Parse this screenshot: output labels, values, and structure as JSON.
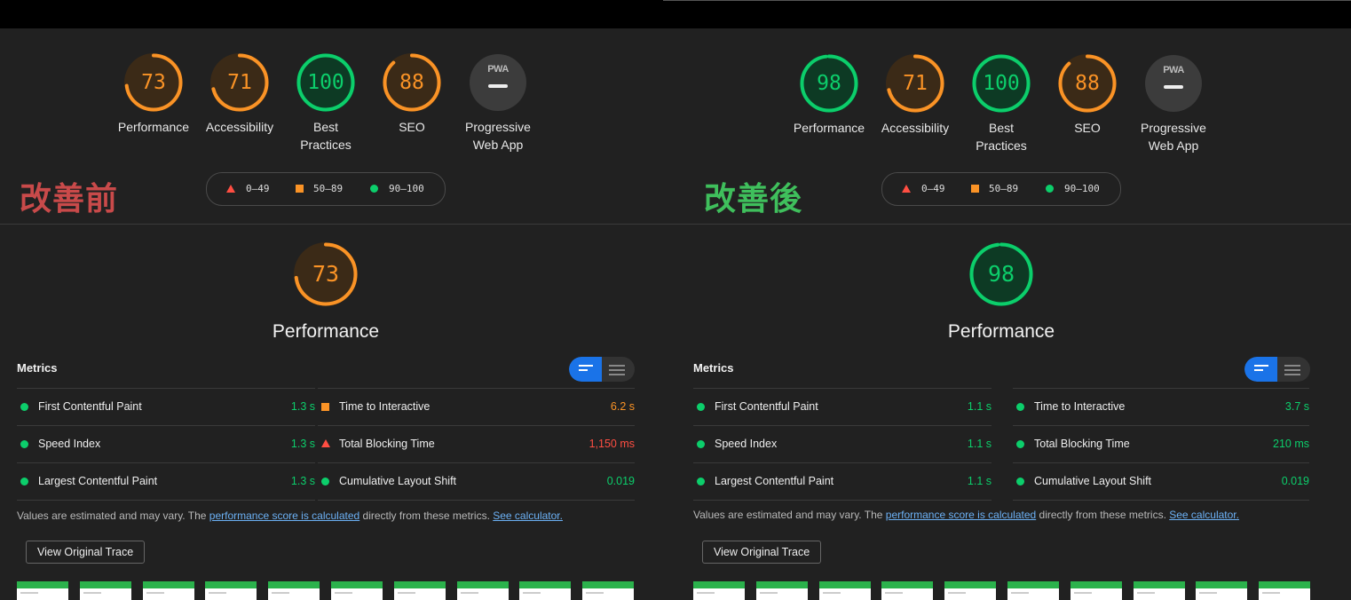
{
  "legend": {
    "low": "0–49",
    "mid": "50–89",
    "high": "90–100"
  },
  "colors": {
    "orange": "#fa9326",
    "green": "#0cce6b",
    "red": "#ff4e42",
    "blue": "#1a73e8"
  },
  "before": {
    "heading": "改善前",
    "heading_color": "#c94a4a",
    "scores": [
      {
        "value": "73",
        "label": "Performance",
        "status": "orange",
        "fraction": 0.73
      },
      {
        "value": "71",
        "label": "Accessibility",
        "status": "orange",
        "fraction": 0.71
      },
      {
        "value": "100",
        "label": "Best Practices",
        "status": "green",
        "fraction": 1.0
      },
      {
        "value": "88",
        "label": "SEO",
        "status": "orange",
        "fraction": 0.88
      }
    ],
    "pwa": {
      "badge": "PWA",
      "label": "Progressive Web App"
    },
    "performance": {
      "value": "73",
      "label": "Performance",
      "status": "orange",
      "fraction": 0.73
    },
    "metrics_title": "Metrics",
    "metrics_left": [
      {
        "name": "First Contentful Paint",
        "value": "1.3 s",
        "status": "green"
      },
      {
        "name": "Speed Index",
        "value": "1.3 s",
        "status": "green"
      },
      {
        "name": "Largest Contentful Paint",
        "value": "1.3 s",
        "status": "green"
      }
    ],
    "metrics_right": [
      {
        "name": "Time to Interactive",
        "value": "6.2 s",
        "status": "orange"
      },
      {
        "name": "Total Blocking Time",
        "value": "1,150 ms",
        "status": "red"
      },
      {
        "name": "Cumulative Layout Shift",
        "value": "0.019",
        "status": "green"
      }
    ],
    "note": {
      "prefix": "Values are estimated and may vary. The ",
      "link1": "performance score is calculated",
      "middle": " directly from these metrics. ",
      "link2": "See calculator."
    },
    "trace_button": "View Original Trace",
    "thumbnail_count": 10
  },
  "after": {
    "heading": "改善後",
    "heading_color": "#3fbf5c",
    "scores": [
      {
        "value": "98",
        "label": "Performance",
        "status": "green",
        "fraction": 0.98
      },
      {
        "value": "71",
        "label": "Accessibility",
        "status": "orange",
        "fraction": 0.71
      },
      {
        "value": "100",
        "label": "Best Practices",
        "status": "green",
        "fraction": 1.0
      },
      {
        "value": "88",
        "label": "SEO",
        "status": "orange",
        "fraction": 0.88
      }
    ],
    "pwa": {
      "badge": "PWA",
      "label": "Progressive Web App"
    },
    "performance": {
      "value": "98",
      "label": "Performance",
      "status": "green",
      "fraction": 0.98
    },
    "metrics_title": "Metrics",
    "metrics_left": [
      {
        "name": "First Contentful Paint",
        "value": "1.1 s",
        "status": "green"
      },
      {
        "name": "Speed Index",
        "value": "1.1 s",
        "status": "green"
      },
      {
        "name": "Largest Contentful Paint",
        "value": "1.1 s",
        "status": "green"
      }
    ],
    "metrics_right": [
      {
        "name": "Time to Interactive",
        "value": "3.7 s",
        "status": "green"
      },
      {
        "name": "Total Blocking Time",
        "value": "210 ms",
        "status": "green"
      },
      {
        "name": "Cumulative Layout Shift",
        "value": "0.019",
        "status": "green"
      }
    ],
    "note": {
      "prefix": "Values are estimated and may vary. The ",
      "link1": "performance score is calculated",
      "middle": " directly from these metrics. ",
      "link2": "See calculator."
    },
    "trace_button": "View Original Trace",
    "thumbnail_count": 10
  }
}
